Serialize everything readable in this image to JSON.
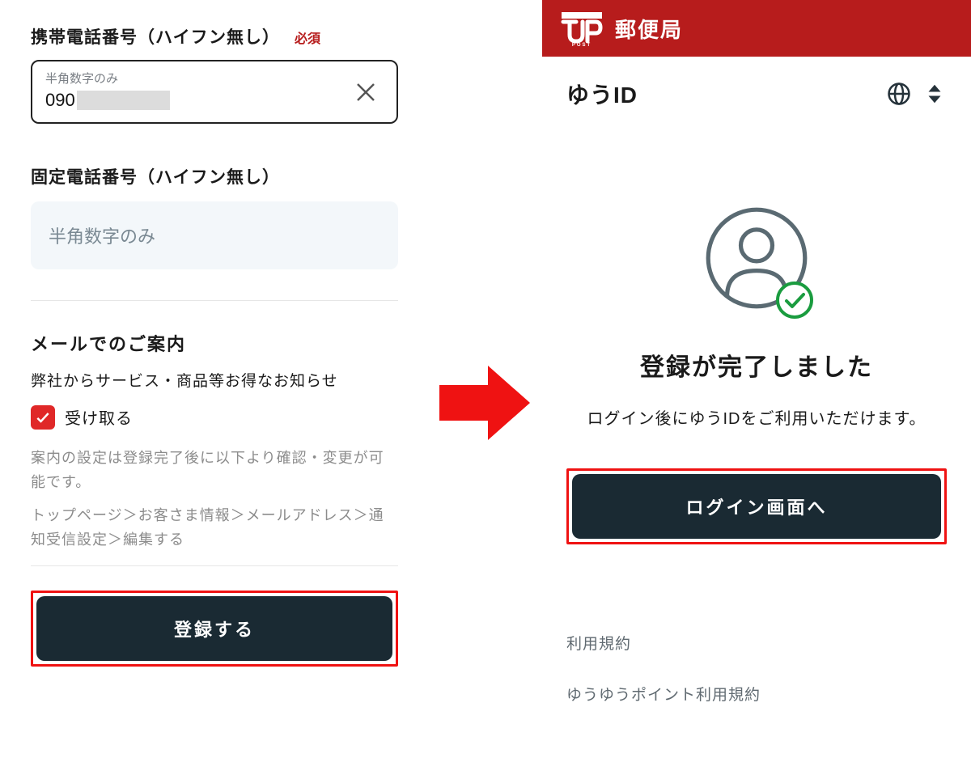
{
  "left": {
    "mobile_label": "携帯電話番号（ハイフン無し）",
    "required": "必須",
    "input_hint": "半角数字のみ",
    "mobile_value": "090",
    "landline_label": "固定電話番号（ハイフン無し）",
    "landline_placeholder": "半角数字のみ",
    "mail_section_title": "メールでのご案内",
    "mail_subtext": "弊社からサービス・商品等お得なお知らせ",
    "checkbox_label": "受け取る",
    "checkbox_checked": true,
    "note1": "案内の設定は登録完了後に以下より確認・変更が可能です。",
    "note2": "トップページ＞お客さま情報＞メールアドレス＞通知受信設定＞編集する",
    "register_button": "登録する"
  },
  "right": {
    "header_title": "郵便局",
    "subheader_title": "ゆうID",
    "success_title": "登録が完了しました",
    "success_sub": "ログイン後にゆうIDをご利用いただけます。",
    "login_button": "ログイン画面へ",
    "footer_link_1": "利用規約",
    "footer_link_2": "ゆうゆうポイント利用規約"
  }
}
